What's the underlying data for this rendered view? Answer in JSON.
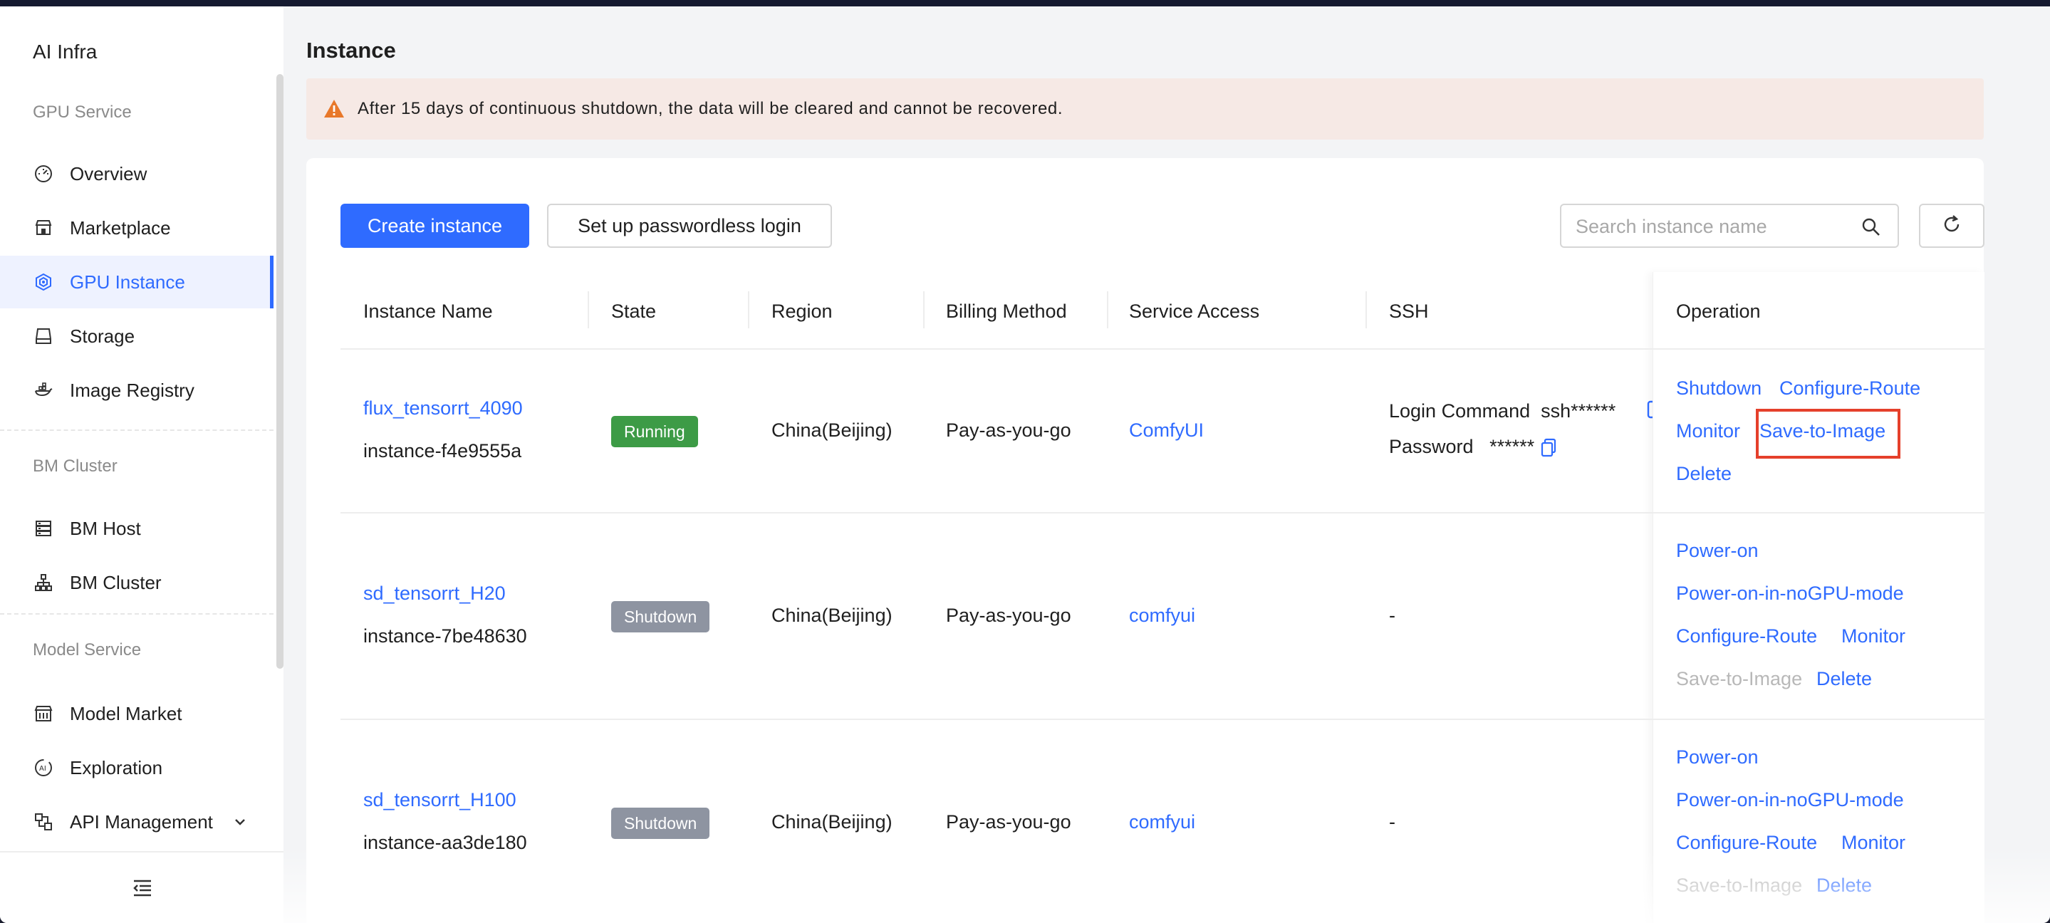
{
  "app": {
    "brand": "AI Infra"
  },
  "sidebar": {
    "sections": [
      {
        "title": "GPU Service"
      },
      {
        "title": "BM Cluster"
      },
      {
        "title": "Model Service"
      }
    ],
    "items": [
      {
        "label": "Overview",
        "icon": "gauge-icon"
      },
      {
        "label": "Marketplace",
        "icon": "store-icon"
      },
      {
        "label": "GPU Instance",
        "icon": "gpu-chip-icon",
        "active": true
      },
      {
        "label": "Storage",
        "icon": "storage-icon"
      },
      {
        "label": "Image Registry",
        "icon": "image-registry-icon"
      },
      {
        "label": "BM Host",
        "icon": "server-list-icon"
      },
      {
        "label": "BM Cluster",
        "icon": "cluster-tree-icon"
      },
      {
        "label": "Model Market",
        "icon": "model-market-icon"
      },
      {
        "label": "Exploration",
        "icon": "ai-explore-icon"
      },
      {
        "label": "API Management",
        "icon": "api-management-icon"
      }
    ]
  },
  "page": {
    "title": "Instance",
    "notice": "After 15 days of continuous shutdown, the data will be cleared and cannot be recovered."
  },
  "toolbar": {
    "create_label": "Create instance",
    "passwordless_label": "Set up passwordless login",
    "search_placeholder": "Search instance name"
  },
  "table": {
    "columns": [
      "Instance Name",
      "State",
      "Region",
      "Billing Method",
      "Service Access",
      "SSH",
      "Operation"
    ],
    "rows": [
      {
        "name": "flux_tensorrt_4090",
        "id": "instance-f4e9555a",
        "state": "Running",
        "region": "China(Beijing)",
        "billing": "Pay-as-you-go",
        "service": "ComfyUI",
        "ssh_login_label": "Login Command",
        "ssh_login_value": "ssh******",
        "ssh_password_label": "Password",
        "ssh_password_value": "******",
        "ops": {
          "a": "Shutdown",
          "b": "Configure-Route",
          "c": "Monitor",
          "d": "Save-to-Image",
          "e": "Delete"
        }
      },
      {
        "name": "sd_tensorrt_H20",
        "id": "instance-7be48630",
        "state": "Shutdown",
        "region": "China(Beijing)",
        "billing": "Pay-as-you-go",
        "service": "comfyui",
        "ssh": "-",
        "ops": {
          "a": "Power-on",
          "b": "Power-on-in-noGPU-mode",
          "c": "Configure-Route",
          "d": "Monitor",
          "e": "Save-to-Image",
          "f": "Delete"
        }
      },
      {
        "name": "sd_tensorrt_H100",
        "id": "instance-aa3de180",
        "state": "Shutdown",
        "region": "China(Beijing)",
        "billing": "Pay-as-you-go",
        "service": "comfyui",
        "ssh": "-",
        "ops": {
          "a": "Power-on",
          "b": "Power-on-in-noGPU-mode",
          "c": "Configure-Route",
          "d": "Monitor",
          "e": "Save-to-Image",
          "f": "Delete"
        }
      }
    ]
  },
  "colors": {
    "accent": "#2f6bff",
    "running": "#3d9b46",
    "shutdown": "#8e94a1",
    "highlight": "#e5402b",
    "notice_bg": "#f6e9e5",
    "warn": "#e8782a"
  }
}
